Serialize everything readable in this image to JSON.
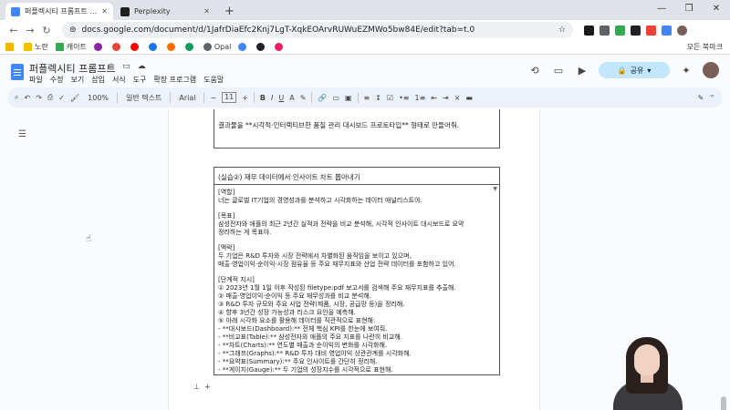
{
  "browser": {
    "tabs": [
      {
        "title": "퍼플렉시티 프롬프트 - Google",
        "color": "#4285f4",
        "active": true
      },
      {
        "title": "Perplexity",
        "color": "#1f1f1f",
        "active": false
      }
    ],
    "new_tab": "+",
    "address": "docs.google.com/document/d/1JafrDiaEfc2Knj7LgT-XqkEOArvRUWuEZMWo5bw84E/edit?tab=t.0",
    "window_controls": [
      "—",
      "❐",
      "✕"
    ]
  },
  "bookmarks": {
    "items": [
      {
        "label": "",
        "color": "#f4b400"
      },
      {
        "label": "노란",
        "color": "#fbbc04"
      },
      {
        "label": "캐이트",
        "color": "#34a853"
      },
      {
        "label": "",
        "color": "#8e24aa"
      },
      {
        "label": "",
        "color": "#ea4335"
      },
      {
        "label": "",
        "color": "#1a73e8"
      },
      {
        "label": "Opal",
        "color": "#5f6368"
      },
      {
        "label": "",
        "color": "#0f9d58"
      }
    ],
    "right": "모든 북마크"
  },
  "docs": {
    "title": "퍼플렉시티 프롬프트",
    "title_icons": [
      "☆",
      "▭",
      "☁"
    ],
    "menu": [
      "파일",
      "수정",
      "보기",
      "삽입",
      "서식",
      "도구",
      "확장 프로그램",
      "도움말"
    ],
    "share_label": "공유"
  },
  "toolbar": {
    "zoom": "100%",
    "style": "일반 텍스트",
    "font": "Arial",
    "font_size": "11",
    "bold": "B",
    "italic": "I",
    "underline": "U",
    "text_color": "A",
    "pen": "✎"
  },
  "document": {
    "top_cell": "결과물을 **시각적·인터랙티브한 품질 관리 대시보드 프로토타입** 형태로 만들어줘.",
    "box_title": "(실습②) 재무 데이터에서 인사이트 차트 뽑아내기",
    "lines": [
      "[역할]",
      "너는 글로벌 IT기업의 경영성과를 분석하고 시각화하는 데이터 애널리스트야.",
      "",
      "[목표]",
      "삼성전자와 애플의 최근 2년간 실적과 전략을 비교 분석해, 시각적 인사이트 대시보드로 요약",
      "정리하는 게 목표야.",
      "",
      "[맥락]",
      "두 기업은 R&D 투자와 시장 전략에서 차별화된 움직임을 보이고 있으며,",
      "매출·영업이익·순이익·시장 점유율 등 주요 재무지표와 산업 전략 데이터를 포함하고 있어.",
      "",
      "[단계적 지시]",
      "① 2023년 1월 1일 이후 작성된 filetype:pdf 보고서를 검색해 주요 재무지표를 추출해.",
      "② 매출·영업이익·순이익 등 주요 재무성과를 비교 분석해.",
      "③ R&D 투자 규모와 주요 사업 전략(제품, 시장, 공급망 등)을 정리해.",
      "④ 향후 3년간 성장 가능성과 리스크 요인을 예측해.",
      "⑤ 아래 시각화 요소를 활용해 데이터를 직관적으로 표현해:",
      "  - **대시보드(Dashboard):** 전체 핵심 KPI를 한눈에 보여줘.",
      "  - **비교표(Table):** 삼성전자와 애플의 주요 지표를 나란히 비교해.",
      "  - **차트(Charts):** 연도별 매출과 순이익의 변화를 시각화해.",
      "  - **그래프(Graphs):** R&D 투자 대비 영업이익 상관관계를 시각화해.",
      "  - **요약표(Summary):** 주요 인사이트를 간단히 정리해.",
      "  - **게이지(Gauge):** 두 기업의 성장지수를 시각적으로 표현해."
    ]
  }
}
